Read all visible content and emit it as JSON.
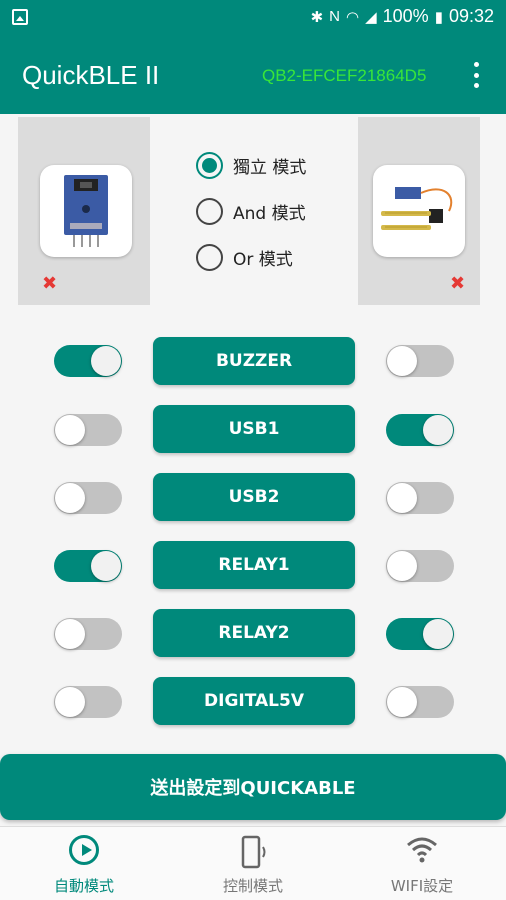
{
  "status_bar": {
    "battery": "100%",
    "time": "09:32",
    "icons": [
      "gallery-icon",
      "bluetooth-icon",
      "nfc-icon",
      "wifi-icon",
      "signal-icon",
      "battery-icon"
    ]
  },
  "app_bar": {
    "title": "QuickBLE II",
    "device_id": "QB2-EFCEF21864D5",
    "device_id_color": "#39e639",
    "menu_icon": "more-vert-icon"
  },
  "sensors": {
    "left": {
      "icon": "sensor-module-icon",
      "remove_icon": "close-icon"
    },
    "right": {
      "icon": "soil-moisture-sensor-icon",
      "remove_icon": "close-icon"
    }
  },
  "modes": [
    {
      "label": "獨立  模式",
      "selected": true
    },
    {
      "label": "And   模式",
      "selected": false
    },
    {
      "label": "Or     模式",
      "selected": false
    }
  ],
  "outputs": [
    {
      "label": "BUZZER",
      "left_on": true,
      "right_on": false
    },
    {
      "label": "USB1",
      "left_on": false,
      "right_on": true
    },
    {
      "label": "USB2",
      "left_on": false,
      "right_on": false
    },
    {
      "label": "RELAY1",
      "left_on": true,
      "right_on": false
    },
    {
      "label": "RELAY2",
      "left_on": false,
      "right_on": true
    },
    {
      "label": "DIGITAL5V",
      "left_on": false,
      "right_on": false
    }
  ],
  "send_button": "送出設定到QUICKABLE",
  "bottom_nav": [
    {
      "label": "自動模式",
      "icon": "play-circle-icon",
      "active": true
    },
    {
      "label": "控制模式",
      "icon": "phone-vibrate-icon",
      "active": false
    },
    {
      "label": "WIFI設定",
      "icon": "wifi-icon",
      "active": false
    }
  ],
  "colors": {
    "primary": "#00897b",
    "switch_off": "#c2c2c2",
    "remove": "#e53935"
  }
}
